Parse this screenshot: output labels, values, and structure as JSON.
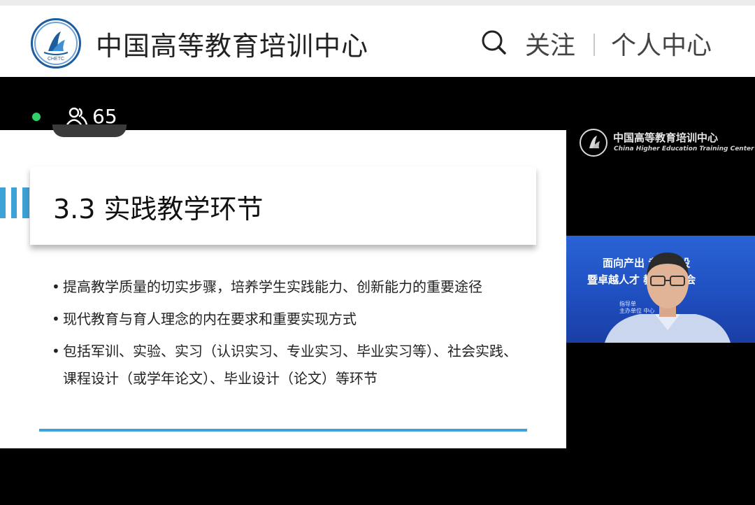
{
  "header": {
    "title": "中国高等教育培训中心",
    "follow_label": "关注",
    "profile_label": "个人中心",
    "logo_text": "CHETC"
  },
  "stream": {
    "viewer_count": "65"
  },
  "slide": {
    "title": "3.3 实践教学环节",
    "bullets": [
      "提高教学质量的切实步骤，培养学生实践能力、创新能力的重要途径",
      "现代教育与育人理念的内在要求和重要实现方式",
      "包括军训、实验、实习（认识实习、专业实习、毕业实习等）、社会实践、课程设计（或学年论文）、毕业设计（论文）等环节"
    ]
  },
  "watermark": {
    "cn": "中国高等教育培训中心",
    "en": "China Higher Education Training Center"
  },
  "speaker": {
    "banner_line1": "面向产出 专业建设",
    "banner_line2": "暨卓越人才 教革研讨会",
    "banner_line3": "指导单",
    "banner_line4": "主办单位 中心"
  },
  "colors": {
    "live_dot": "#2fd06a",
    "accent_line": "#3ea2d6",
    "logo_blue": "#1c5d9e"
  }
}
